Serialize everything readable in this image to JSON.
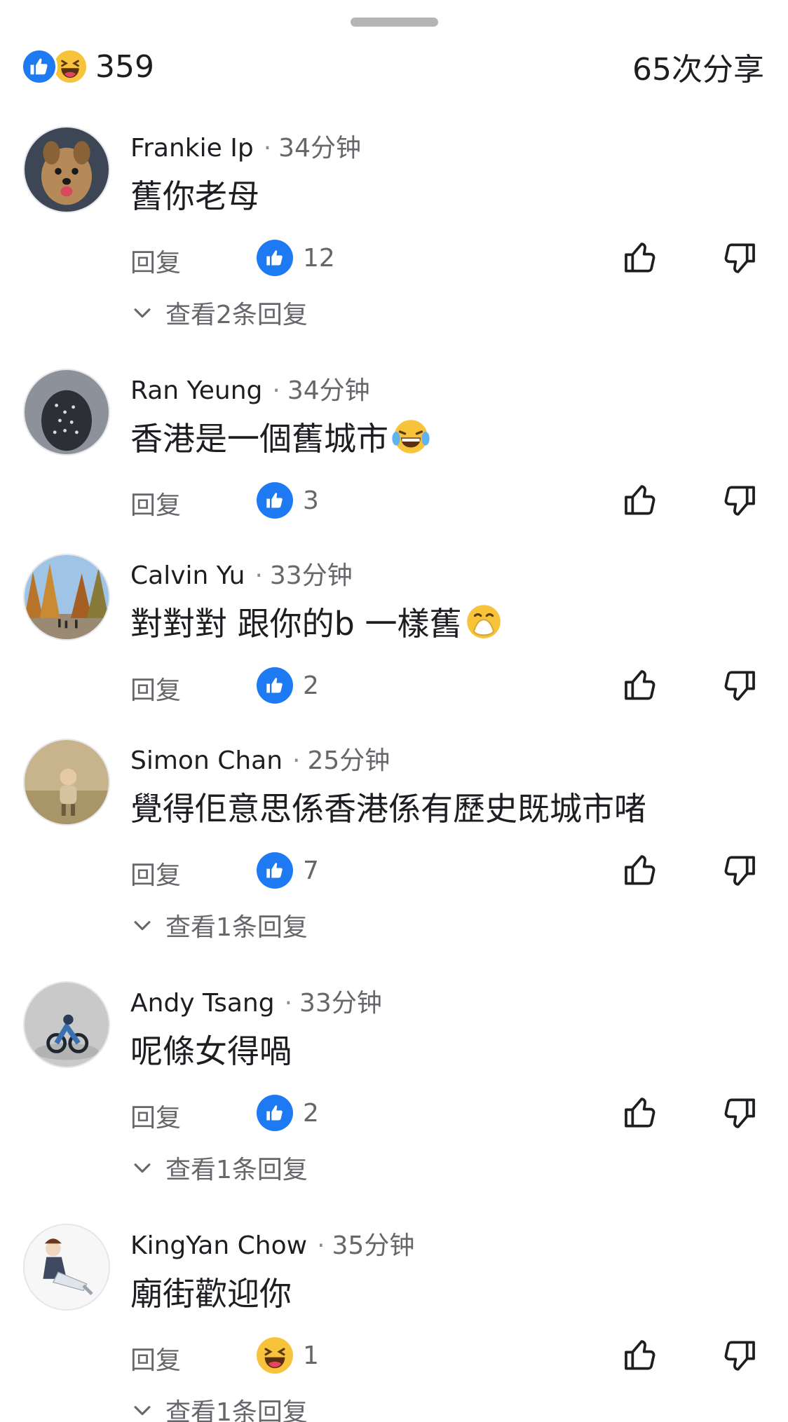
{
  "header": {
    "reaction_count": "359",
    "share_count": "65次分享",
    "reactions": [
      "like-icon",
      "haha-icon"
    ]
  },
  "colors": {
    "like_blue": "#1d7af3",
    "haha_yellow": "#f7c33b",
    "secondary_text": "#65676b"
  },
  "comments": [
    {
      "author": "Frankie Ip",
      "time": "34分钟",
      "text": "舊你老母",
      "reply_label": "回复",
      "reaction_icon": "like-icon",
      "reaction_count": "12",
      "view_replies": "查看2条回复"
    },
    {
      "author": "Ran Yeung",
      "time": "34分钟",
      "text": "香港是一個舊城市",
      "text_emoji": "tears-of-joy-emoji",
      "reply_label": "回复",
      "reaction_icon": "like-icon",
      "reaction_count": "3"
    },
    {
      "author": "Calvin Yu",
      "time": "33分钟",
      "text": "對對對 跟你的b 一樣舊",
      "text_emoji": "hand-over-mouth-emoji",
      "reply_label": "回复",
      "reaction_icon": "like-icon",
      "reaction_count": "2"
    },
    {
      "author": "Simon Chan",
      "time": "25分钟",
      "text": "覺得佢意思係香港係有歷史既城市啫",
      "reply_label": "回复",
      "reaction_icon": "like-icon",
      "reaction_count": "7",
      "view_replies": "查看1条回复"
    },
    {
      "author": "Andy Tsang",
      "time": "33分钟",
      "text": "呢條女得喎",
      "reply_label": "回复",
      "reaction_icon": "like-icon",
      "reaction_count": "2",
      "view_replies": "查看1条回复"
    },
    {
      "author": "KingYan Chow",
      "time": "35分钟",
      "text": "廟街歡迎你",
      "reply_label": "回复",
      "reaction_icon": "haha-icon",
      "reaction_count": "1",
      "view_replies": "查看1条回复"
    }
  ]
}
